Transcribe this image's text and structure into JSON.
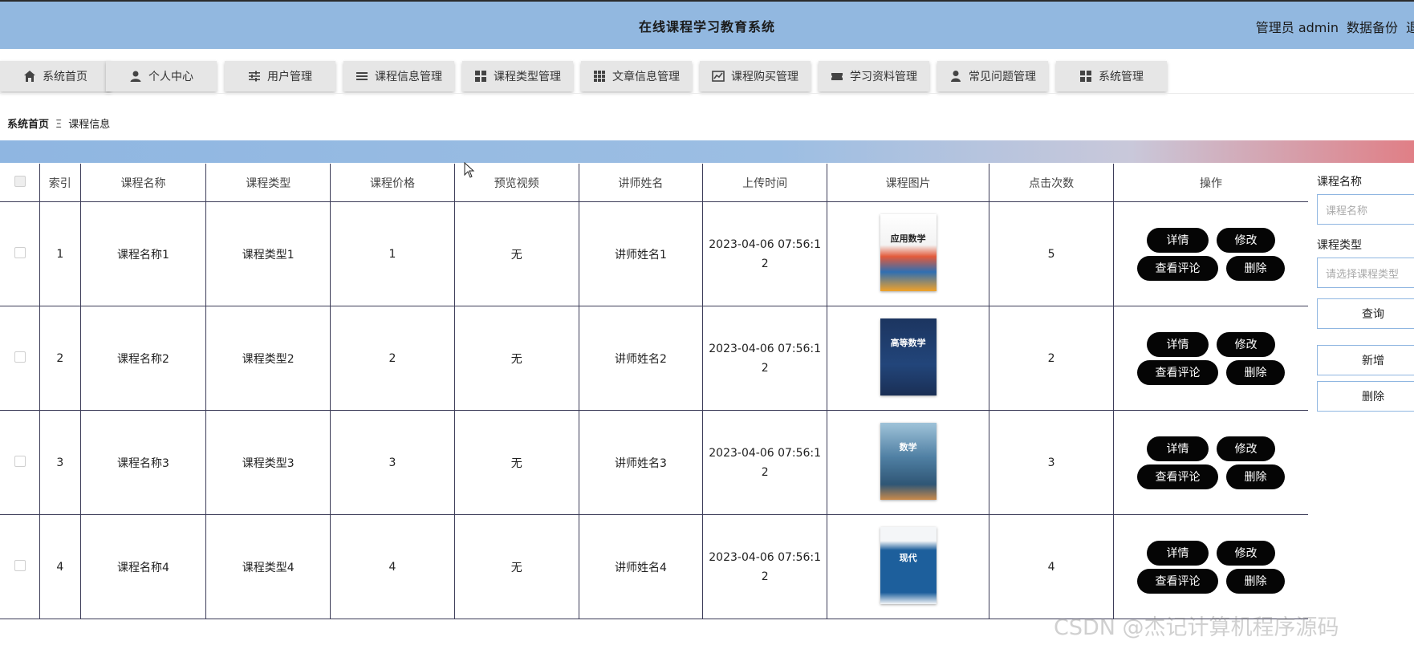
{
  "header": {
    "title": "在线课程学习教育系统",
    "user": "管理员 admin",
    "backup": "数据备份",
    "logout": "退"
  },
  "nav": [
    {
      "label": "系统首页",
      "icon": "home-icon"
    },
    {
      "label": "个人中心",
      "icon": "user-icon"
    },
    {
      "label": "用户管理",
      "icon": "sliders-icon"
    },
    {
      "label": "课程信息管理",
      "icon": "list-icon"
    },
    {
      "label": "课程类型管理",
      "icon": "grid-icon"
    },
    {
      "label": "文章信息管理",
      "icon": "apps-icon"
    },
    {
      "label": "课程购买管理",
      "icon": "chart-icon"
    },
    {
      "label": "学习资料管理",
      "icon": "ticket-icon"
    },
    {
      "label": "常见问题管理",
      "icon": "person-icon"
    },
    {
      "label": "系统管理",
      "icon": "grid-icon"
    }
  ],
  "breadcrumb": {
    "home": "系统首页",
    "sep": "Ξ",
    "current": "课程信息"
  },
  "table": {
    "columns": [
      "索引",
      "课程名称",
      "课程类型",
      "课程价格",
      "预览视频",
      "讲师姓名",
      "上传时间",
      "课程图片",
      "点击次数",
      "操作"
    ],
    "rows": [
      {
        "index": "1",
        "name": "课程名称1",
        "type": "课程类型1",
        "price": "1",
        "video": "无",
        "teacher": "讲师姓名1",
        "time_a": "2023-04-06 07:56:1",
        "time_b": "2",
        "clicks": "5",
        "cover": "应用数学"
      },
      {
        "index": "2",
        "name": "课程名称2",
        "type": "课程类型2",
        "price": "2",
        "video": "无",
        "teacher": "讲师姓名2",
        "time_a": "2023-04-06 07:56:1",
        "time_b": "2",
        "clicks": "2",
        "cover": "高等数学"
      },
      {
        "index": "3",
        "name": "课程名称3",
        "type": "课程类型3",
        "price": "3",
        "video": "无",
        "teacher": "讲师姓名3",
        "time_a": "2023-04-06 07:56:1",
        "time_b": "2",
        "clicks": "3",
        "cover": "数学"
      },
      {
        "index": "4",
        "name": "课程名称4",
        "type": "课程类型4",
        "price": "4",
        "video": "无",
        "teacher": "讲师姓名4",
        "time_a": "2023-04-06 07:56:1",
        "time_b": "2",
        "clicks": "4",
        "cover": "现代"
      }
    ],
    "actions": {
      "detail": "详情",
      "edit": "修改",
      "comments": "查看评论",
      "delete": "删除"
    }
  },
  "search": {
    "name_label": "课程名称",
    "name_placeholder": "课程名称",
    "type_label": "课程类型",
    "type_placeholder": "请选择课程类型",
    "query": "查询",
    "add": "新增",
    "delete": "删除"
  },
  "watermark": "CSDN @杰记计算机程序源码",
  "colors": {
    "header": "#92b8e0",
    "button": "#050505",
    "band_end": "#e07f86"
  }
}
